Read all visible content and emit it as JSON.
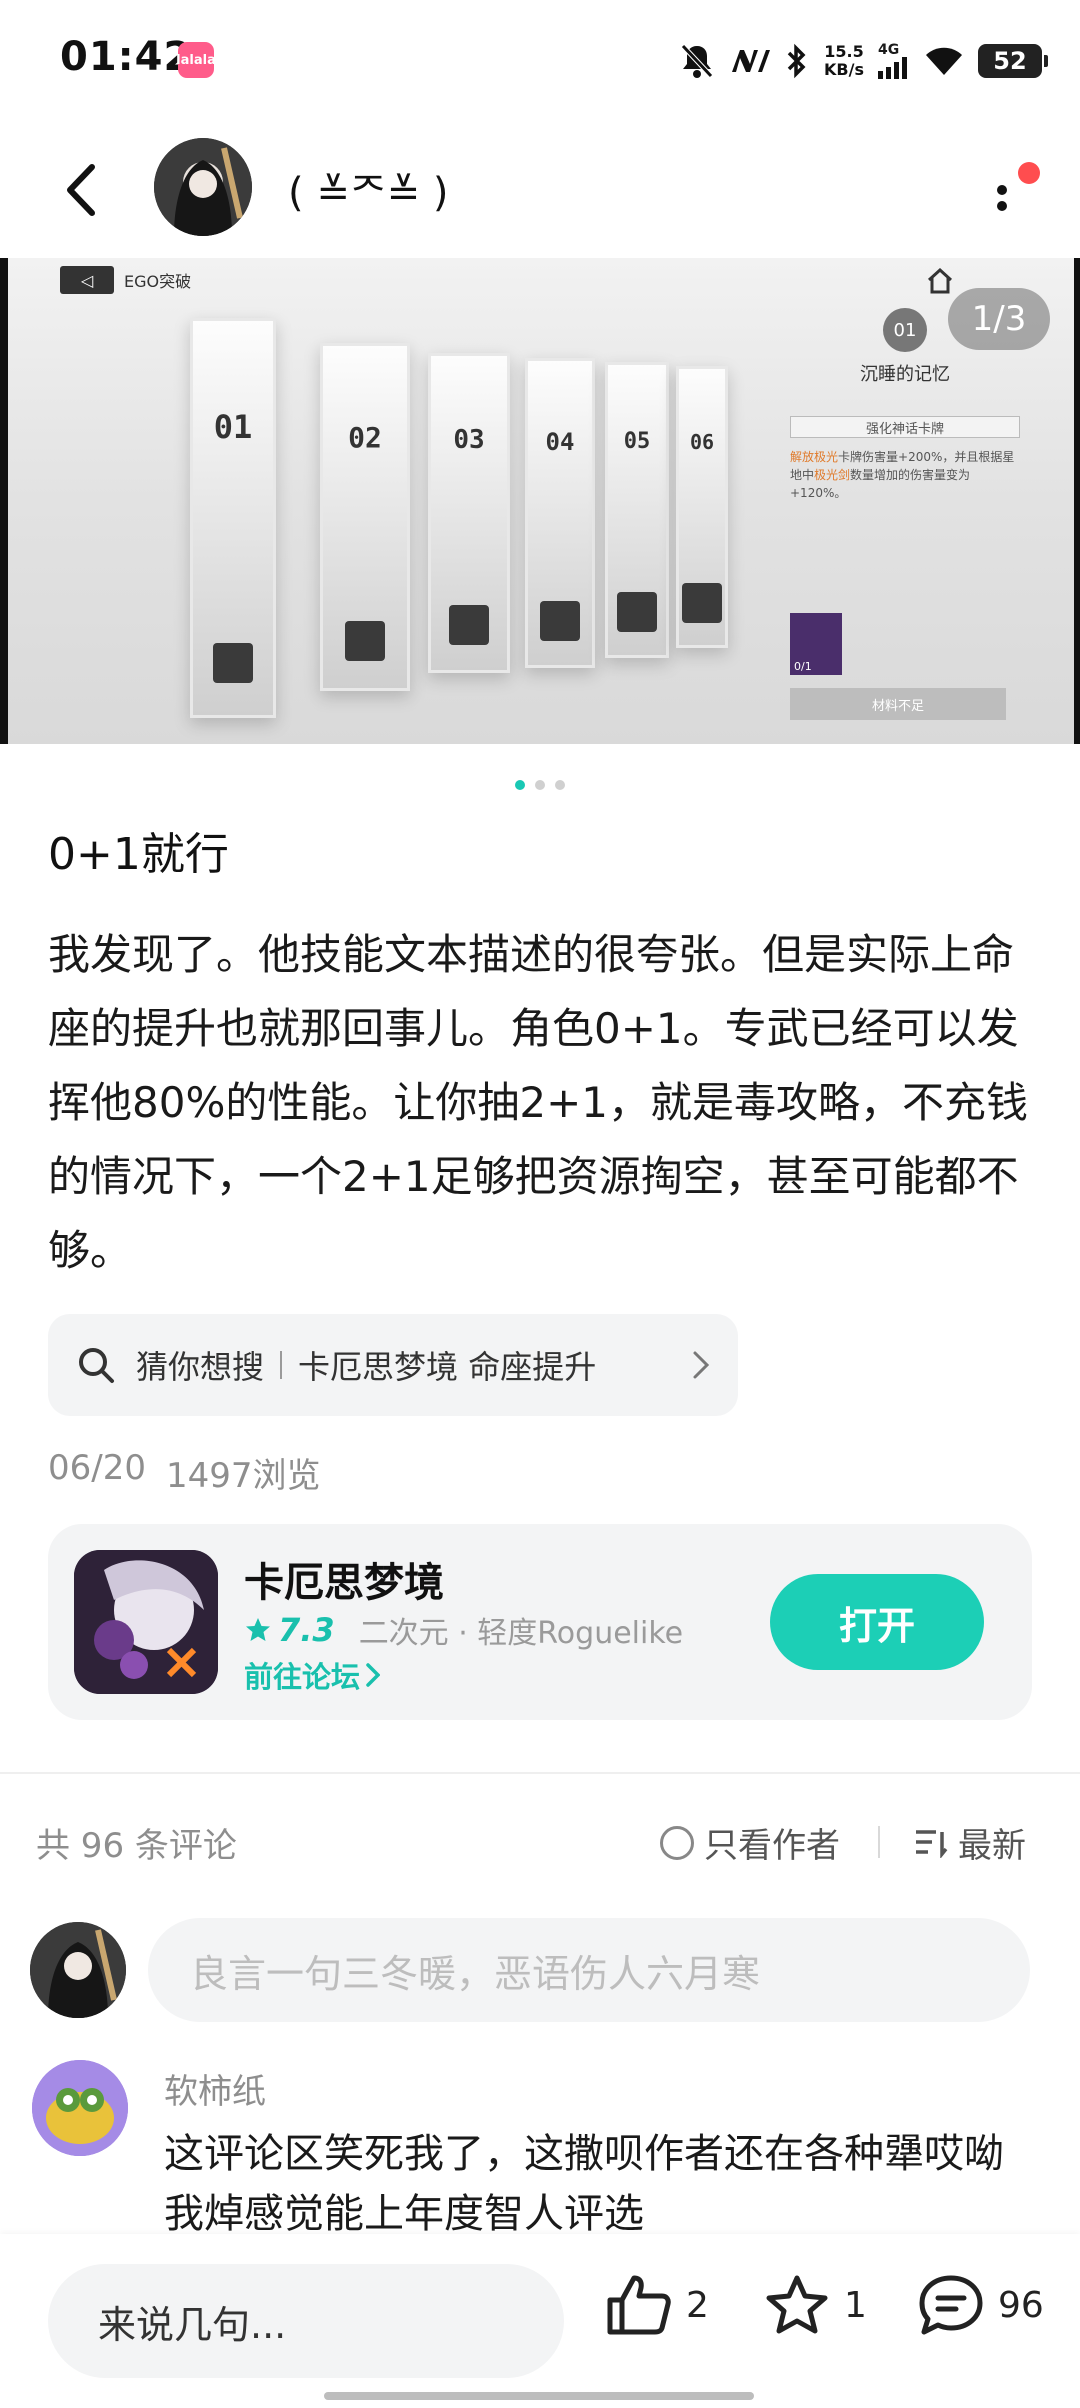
{
  "status_bar": {
    "time": "01:42",
    "app_badge": "lalala",
    "net_speed_value": "15.5",
    "net_speed_unit": "KB/s",
    "network": "4G",
    "battery": "52"
  },
  "header": {
    "author_name": "( ≚ᄌ≚ )",
    "avatar_icon": "author-avatar"
  },
  "carousel": {
    "page_indicator": "1/3",
    "ego_label": "EGO突破",
    "panel_numbers": [
      "01",
      "02",
      "03",
      "04",
      "05",
      "06"
    ],
    "side_circle": "01",
    "side_title": "沉睡的记忆",
    "side_box": "强化神话卡牌",
    "side_desc_1": "解放极光",
    "side_desc_2": "卡牌伤害量+200%，并且根据星地中",
    "side_desc_3": "极光剑",
    "side_desc_4": "数量增加的伤害量变为+120%。",
    "side_item_count": "0/1",
    "side_button": "材料不足",
    "dots": 3,
    "active_dot": 0
  },
  "post": {
    "title": "0+1就行",
    "body": "我发现了。他技能文本描述的很夸张。但是实际上命座的提升也就那回事儿。角色0+1。专武已经可以发挥他80%的性能。让你抽2+1，就是毒攻略，不充钱的情况下，一个2+1足够把资源掏空，甚至可能都不够。",
    "search_label": "猜你想搜",
    "search_text": "卡厄思梦境 命座提升",
    "date": "06/20",
    "views": "1497浏览"
  },
  "game_card": {
    "name": "卡厄思梦境",
    "score": "7.3",
    "tags": "二次元 · 轻度Roguelike",
    "forum_link": "前往论坛",
    "open_button": "打开",
    "accent_color": "#1ccfb6"
  },
  "comments": {
    "count_label": "共 96 条评论",
    "only_author": "只看作者",
    "sort_label": "最新",
    "input_placeholder": "良言一句三冬暖，恶语伤人六月寒",
    "items": [
      {
        "user": "软柿纸",
        "text": "这评论区笑死我了，这撒呗作者还在各种犟哎呦我焯感觉能上年度智人评选"
      }
    ]
  },
  "bottom_bar": {
    "reply_placeholder": "来说几句...",
    "likes": "2",
    "favorites": "1",
    "comments": "96"
  }
}
